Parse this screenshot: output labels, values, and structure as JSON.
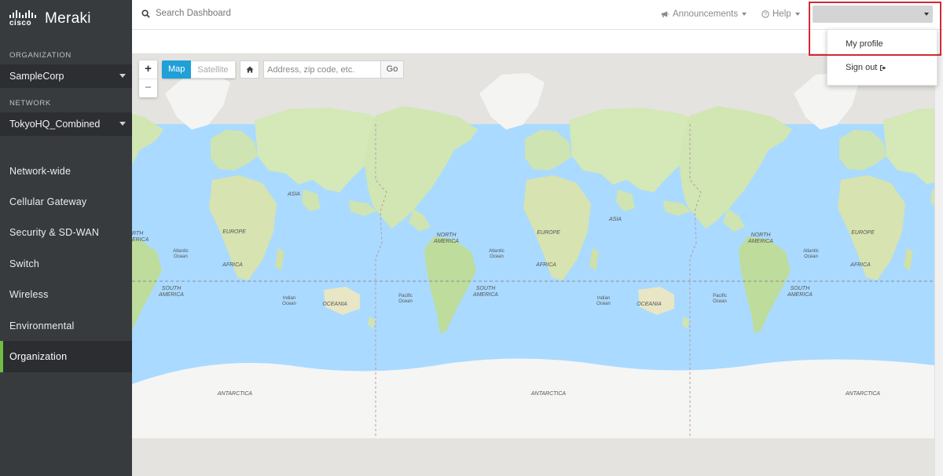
{
  "brand": {
    "logo_word": "cisco",
    "product_name": "Meraki"
  },
  "sidebar": {
    "organization_label": "ORGANIZATION",
    "organization_value": "SampleCorp",
    "network_label": "NETWORK",
    "network_value": "TokyoHQ_Combined",
    "items": [
      {
        "label": "Network-wide"
      },
      {
        "label": "Cellular Gateway"
      },
      {
        "label": "Security & SD-WAN"
      },
      {
        "label": "Switch"
      },
      {
        "label": "Wireless"
      },
      {
        "label": "Environmental"
      },
      {
        "label": "Organization",
        "active": true
      }
    ]
  },
  "topbar": {
    "search_text": "Search Dashboard",
    "announcements_label": "Announcements",
    "help_label": "Help"
  },
  "map_controls": {
    "zoom_in": "+",
    "zoom_out": "−",
    "map_label": "Map",
    "satellite_label": "Satellite",
    "address_placeholder": "Address, zip code, etc.",
    "go_label": "Go"
  },
  "user_menu": {
    "my_profile": "My profile",
    "sign_out": "Sign out"
  },
  "map_labels": {
    "north_america": [
      "NORTH",
      "AMERICA"
    ],
    "south_america": [
      "SOUTH",
      "AMERICA"
    ],
    "europe": "EUROPE",
    "asia": "ASIA",
    "africa": "AFRICA",
    "oceania": "OCEANIA",
    "antarctica": "ANTARCTICA",
    "atlantic_ocean": [
      "Atlantic",
      "Ocean"
    ],
    "indian_ocean": [
      "Indian",
      "Ocean"
    ],
    "pacific_ocean": [
      "Pacific",
      "Ocean"
    ],
    "clipped_north_america": [
      "RTH",
      "ERICA"
    ]
  },
  "colors": {
    "sidebar_bg": "#383b3e",
    "selector_bg": "#2c2e31",
    "active_accent": "#6ebe44",
    "map_button_active": "#1fa0d7",
    "ocean": "#aadaff",
    "land": "#d3e8b8",
    "highlight_border": "#d02a33"
  },
  "icons": {
    "search": "search-icon",
    "announcements": "megaphone-icon",
    "help": "question-circle-icon",
    "home": "home-icon",
    "sign_out": "sign-out-icon"
  }
}
